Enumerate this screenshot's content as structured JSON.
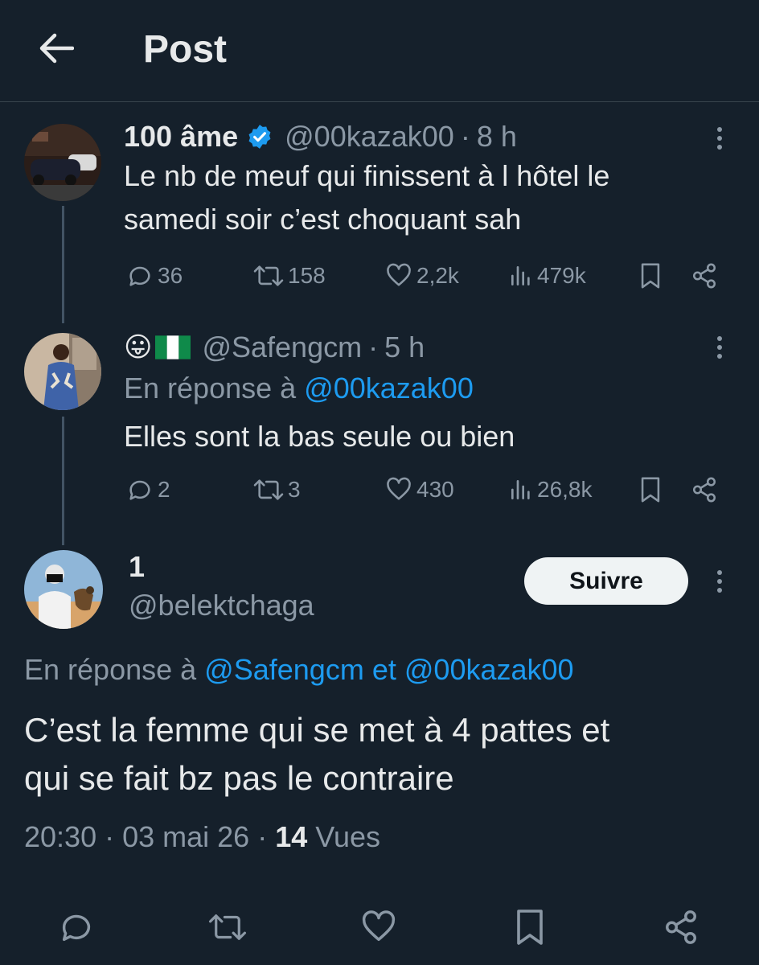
{
  "header": {
    "title": "Post",
    "back_icon": "arrow-left-icon"
  },
  "tweets": [
    {
      "name": "100 âme",
      "verified": true,
      "handle": "@00kazak00",
      "time": "8 h",
      "text_lines": [
        "Le nb de meuf qui finissent à l hôtel le",
        "samedi soir c’est choquant sah"
      ],
      "replies": "36",
      "retweets": "158",
      "likes": "2,2k",
      "views": "479k"
    },
    {
      "emoji": "😛",
      "flag": "Nigeria flag",
      "handle": "@Safengcm",
      "time": "5 h",
      "reply_prefix": "En réponse à",
      "reply_to": "@00kazak00",
      "text": "Elles sont la bas seule ou bien",
      "replies": "2",
      "retweets": "3",
      "likes": "430",
      "views": "26,8k"
    }
  ],
  "main_tweet": {
    "name": "1",
    "handle": "@belektchaga",
    "follow_label": "Suivre",
    "reply_prefix": "En réponse à",
    "reply_to_1": "@Safengcm",
    "reply_conj": "et",
    "reply_to_2": "@00kazak00",
    "text_lines": [
      "C’est la femme qui se met à 4 pattes et",
      "qui se fait bz pas le contraire"
    ],
    "time": "20:30",
    "date": "03 mai 26",
    "views_count": "14",
    "views_label": "Vues"
  },
  "bottom_actions": [
    "reply-icon",
    "retweet-icon",
    "like-icon",
    "bookmark-icon",
    "share-icon"
  ],
  "colors": {
    "background": "#15202b",
    "link": "#1d9bf0",
    "muted": "#8b98a5",
    "verified": "#1d9bf0"
  }
}
